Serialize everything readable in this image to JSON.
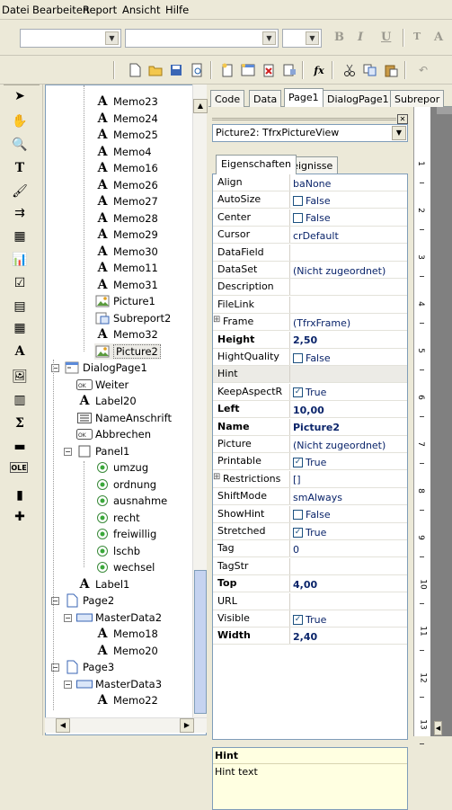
{
  "menu": [
    "Datei",
    "Bearbeiten",
    "Report",
    "Ansicht",
    "Hilfe"
  ],
  "toolbar": {
    "font_name": "",
    "font_size": "",
    "bold_label": "B",
    "italic_label": "I",
    "underline_label": "U",
    "icons": [
      "new-icon",
      "open-icon",
      "save-icon",
      "preview-icon",
      "new-page-icon",
      "new-dialog-icon",
      "delete-page-icon",
      "page-settings-icon",
      "function-icon",
      "cut-icon",
      "copy-icon",
      "paste-icon"
    ]
  },
  "left_tools": [
    "select-icon",
    "hand-icon",
    "zoom-icon",
    "text-edit-icon",
    "format-painter-icon",
    "align-icon",
    "band-icon",
    "chart-icon",
    "checkbox-icon",
    "subreport-icon",
    "cross-tab-icon",
    "text-object-icon",
    "picture-icon",
    "rich-text-icon",
    "system-text-icon",
    "line-icon",
    "ole-icon",
    "barcode-icon",
    "more-tools-icon"
  ],
  "tree": {
    "items": [
      {
        "label": "Memo23",
        "icon": "text-object-icon"
      },
      {
        "label": "Memo24",
        "icon": "text-object-icon"
      },
      {
        "label": "Memo25",
        "icon": "text-object-icon"
      },
      {
        "label": "Memo4",
        "icon": "text-object-icon"
      },
      {
        "label": "Memo16",
        "icon": "text-object-icon"
      },
      {
        "label": "Memo26",
        "icon": "text-object-icon"
      },
      {
        "label": "Memo27",
        "icon": "text-object-icon"
      },
      {
        "label": "Memo28",
        "icon": "text-object-icon"
      },
      {
        "label": "Memo29",
        "icon": "text-object-icon"
      },
      {
        "label": "Memo30",
        "icon": "text-object-icon"
      },
      {
        "label": "Memo11",
        "icon": "text-object-icon"
      },
      {
        "label": "Memo31",
        "icon": "text-object-icon"
      },
      {
        "label": "Picture1",
        "icon": "picture-icon"
      },
      {
        "label": "Subreport2",
        "icon": "subreport-icon"
      },
      {
        "label": "Memo32",
        "icon": "text-object-icon"
      },
      {
        "label": "Picture2",
        "icon": "picture-icon"
      },
      {
        "label": "DialogPage1",
        "icon": "dialog-page-icon"
      },
      {
        "label": "Weiter",
        "icon": "button-icon"
      },
      {
        "label": "Label20",
        "icon": "text-object-icon"
      },
      {
        "label": "NameAnschrift",
        "icon": "listbox-icon"
      },
      {
        "label": "Abbrechen",
        "icon": "button-icon"
      },
      {
        "label": "Panel1",
        "icon": "panel-icon"
      },
      {
        "label": "umzug",
        "icon": "radio-icon"
      },
      {
        "label": "ordnung",
        "icon": "radio-icon"
      },
      {
        "label": "ausnahme",
        "icon": "radio-icon"
      },
      {
        "label": "recht",
        "icon": "radio-icon"
      },
      {
        "label": "freiwillig",
        "icon": "radio-icon"
      },
      {
        "label": "lschb",
        "icon": "radio-icon"
      },
      {
        "label": "wechsel",
        "icon": "radio-icon"
      },
      {
        "label": "Label1",
        "icon": "text-object-icon"
      },
      {
        "label": "Page2",
        "icon": "page-icon"
      },
      {
        "label": "MasterData2",
        "icon": "band-icon"
      },
      {
        "label": "Memo18",
        "icon": "text-object-icon"
      },
      {
        "label": "Memo20",
        "icon": "text-object-icon"
      },
      {
        "label": "Page3",
        "icon": "page-icon"
      },
      {
        "label": "MasterData3",
        "icon": "band-icon"
      },
      {
        "label": "Memo22",
        "icon": "text-object-icon"
      }
    ]
  },
  "tabs": [
    "Code",
    "Data",
    "Page1",
    "DialogPage1",
    "Subrepor"
  ],
  "active_tab": "Page1",
  "object_selector": "Picture2: TfrxPictureView",
  "inspector_tabs": [
    "Eigenschaften",
    "Ereignisse"
  ],
  "properties": [
    {
      "name": "Align",
      "value": "baNone",
      "bold": false,
      "type": "text"
    },
    {
      "name": "AutoSize",
      "value": "False",
      "bold": false,
      "type": "bool",
      "checked": false
    },
    {
      "name": "Center",
      "value": "False",
      "bold": false,
      "type": "bool",
      "checked": false
    },
    {
      "name": "Cursor",
      "value": "crDefault",
      "bold": false,
      "type": "text"
    },
    {
      "name": "DataField",
      "value": "",
      "bold": false,
      "type": "text"
    },
    {
      "name": "DataSet",
      "value": "(Nicht zugeordnet)",
      "bold": false,
      "type": "text"
    },
    {
      "name": "Description",
      "value": "",
      "bold": false,
      "type": "text"
    },
    {
      "name": "FileLink",
      "value": "",
      "bold": false,
      "type": "text"
    },
    {
      "name": "Frame",
      "value": "(TfrxFrame)",
      "bold": false,
      "type": "text",
      "expand": true
    },
    {
      "name": "Height",
      "value": "2,50",
      "bold": true,
      "type": "text"
    },
    {
      "name": "HightQuality",
      "value": "False",
      "bold": false,
      "type": "bool",
      "checked": false
    },
    {
      "name": "Hint",
      "value": "",
      "bold": false,
      "type": "text",
      "selected": true
    },
    {
      "name": "KeepAspectR",
      "value": "True",
      "bold": false,
      "type": "bool",
      "checked": true
    },
    {
      "name": "Left",
      "value": "10,00",
      "bold": true,
      "type": "text"
    },
    {
      "name": "Name",
      "value": "Picture2",
      "bold": true,
      "type": "text"
    },
    {
      "name": "Picture",
      "value": "(Nicht zugeordnet)",
      "bold": false,
      "type": "text"
    },
    {
      "name": "Printable",
      "value": "True",
      "bold": false,
      "type": "bool",
      "checked": true
    },
    {
      "name": "Restrictions",
      "value": "[]",
      "bold": false,
      "type": "text",
      "expand": true
    },
    {
      "name": "ShiftMode",
      "value": "smAlways",
      "bold": false,
      "type": "text"
    },
    {
      "name": "ShowHint",
      "value": "False",
      "bold": false,
      "type": "bool",
      "checked": false
    },
    {
      "name": "Stretched",
      "value": "True",
      "bold": false,
      "type": "bool",
      "checked": true
    },
    {
      "name": "Tag",
      "value": "0",
      "bold": false,
      "type": "text"
    },
    {
      "name": "TagStr",
      "value": "",
      "bold": false,
      "type": "text"
    },
    {
      "name": "Top",
      "value": "4,00",
      "bold": true,
      "type": "text"
    },
    {
      "name": "URL",
      "value": "",
      "bold": false,
      "type": "text"
    },
    {
      "name": "Visible",
      "value": "True",
      "bold": false,
      "type": "bool",
      "checked": true
    },
    {
      "name": "Width",
      "value": "2,40",
      "bold": true,
      "type": "text"
    }
  ],
  "hint": {
    "title": "Hint",
    "text": "Hint text"
  },
  "ruler_labels": [
    "1",
    "2",
    "3",
    "4",
    "5",
    "6",
    "7",
    "8",
    "9",
    "10",
    "11",
    "12",
    "13"
  ]
}
